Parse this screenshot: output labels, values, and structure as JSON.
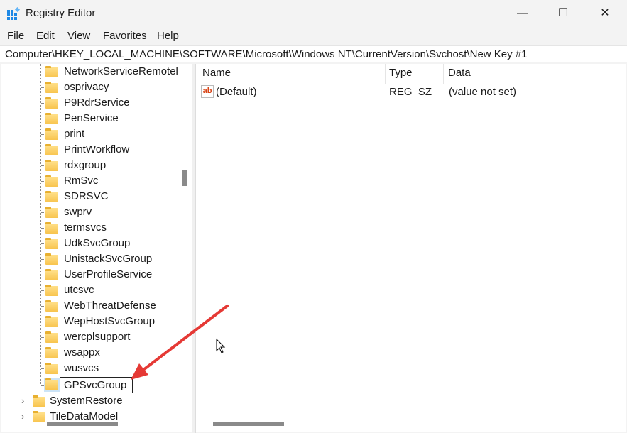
{
  "window": {
    "title": "Registry Editor",
    "minimize": "—",
    "maximize": "☐",
    "close": "✕"
  },
  "menu": [
    "File",
    "Edit",
    "View",
    "Favorites",
    "Help"
  ],
  "address": "Computer\\HKEY_LOCAL_MACHINE\\SOFTWARE\\Microsoft\\Windows NT\\CurrentVersion\\Svchost\\New Key #1",
  "tree": [
    "NetworkServiceRemotel",
    "osprivacy",
    "P9RdrService",
    "PenService",
    "print",
    "PrintWorkflow",
    "rdxgroup",
    "RmSvc",
    "SDRSVC",
    "swprv",
    "termsvcs",
    "UdkSvcGroup",
    "UnistackSvcGroup",
    "UserProfileService",
    "utcsvc",
    "WebThreatDefense",
    "WepHostSvcGroup",
    "wercplsupport",
    "wsappx",
    "wusvcs"
  ],
  "editing_key": "GPSvcGroup",
  "tree_parent": [
    "SystemRestore",
    "TileDataModel"
  ],
  "columns": {
    "name": "Name",
    "type": "Type",
    "data": "Data"
  },
  "values": [
    {
      "name": "(Default)",
      "type": "REG_SZ",
      "data": "(value not set)"
    }
  ],
  "accent": "#e53935"
}
